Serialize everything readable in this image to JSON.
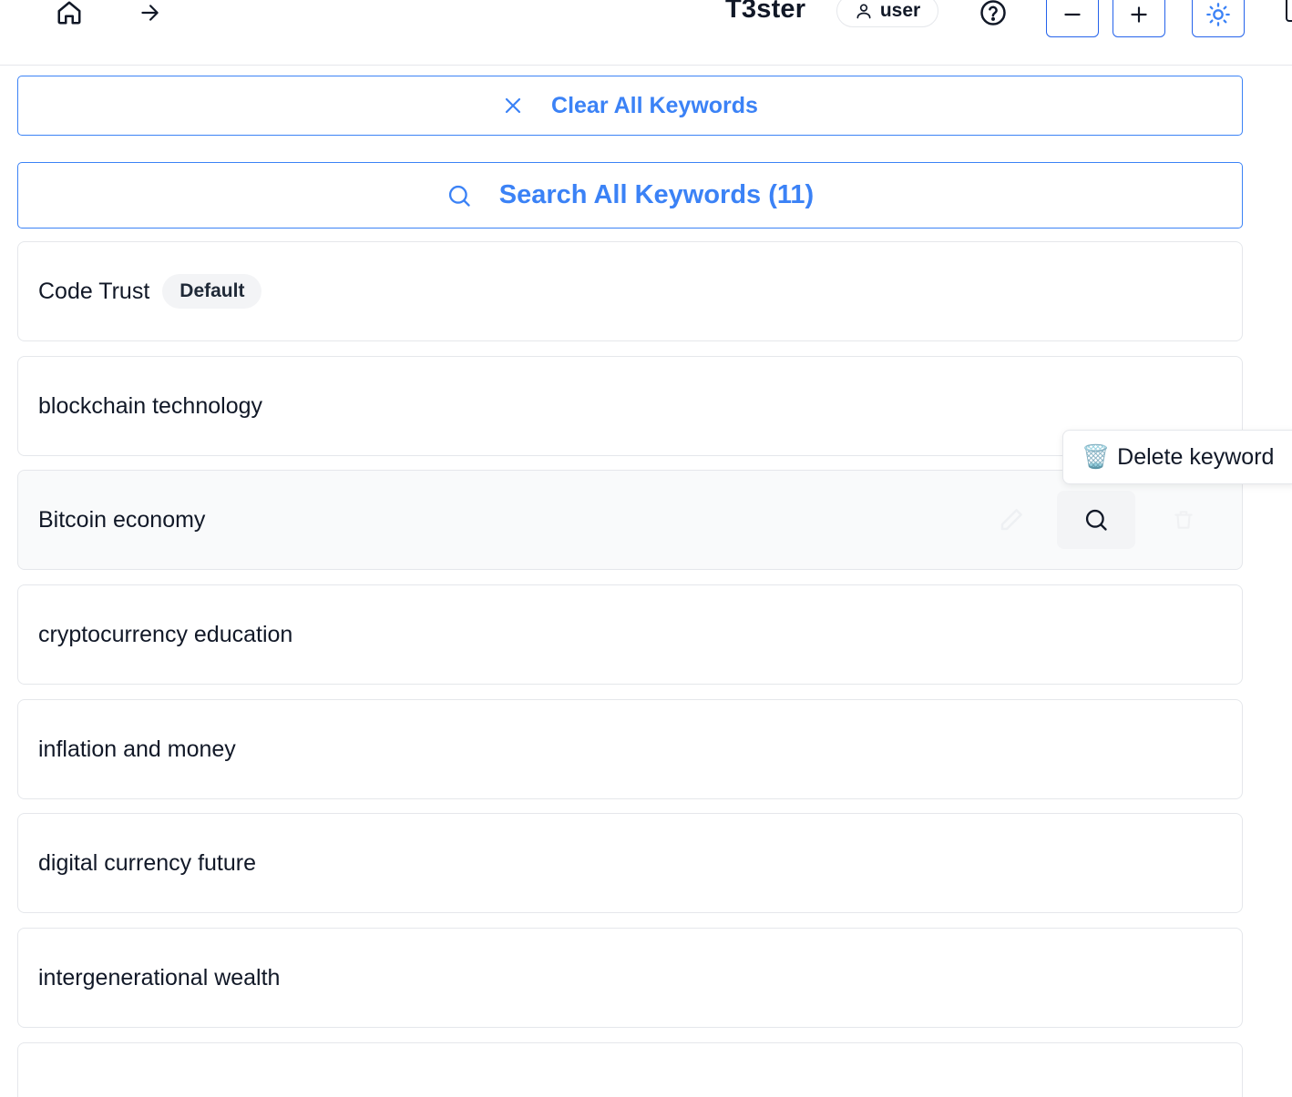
{
  "header": {
    "title": "T3ster",
    "user_label": "user",
    "home_icon": "home-icon",
    "forward_icon": "arrow-right-icon",
    "help_icon": "help-circle-icon",
    "zoom_out_icon": "minus-icon",
    "zoom_in_icon": "plus-icon",
    "theme_icon": "sun-icon"
  },
  "actions": {
    "clear_label": "Clear All Keywords",
    "search_label": "Search All Keywords (11)"
  },
  "keywords": [
    {
      "label": "Code Trust",
      "badge": "Default"
    },
    {
      "label": "blockchain technology"
    },
    {
      "label": "Bitcoin economy"
    },
    {
      "label": "cryptocurrency education"
    },
    {
      "label": "inflation and money"
    },
    {
      "label": "digital currency future"
    },
    {
      "label": "intergenerational wealth"
    },
    {
      "label": ""
    }
  ],
  "tooltip": {
    "text": "Delete keyword",
    "emoji": "🗑️"
  },
  "colors": {
    "accent": "#3b82f6",
    "border": "#e5e7eb",
    "hover_bg": "#f9fafb"
  }
}
